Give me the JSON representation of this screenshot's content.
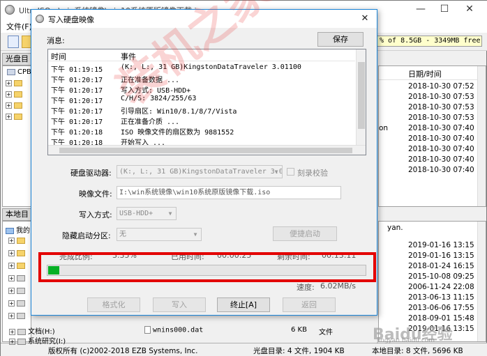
{
  "main_window": {
    "title": "UltraISO - \\win系统镜像\\win10系统原版镜像下载.iso",
    "menu_first": "文件(F)",
    "capacity": "% of 8.5GB - 3349MB free",
    "cd_panel_label": "光盘目录",
    "cd_root": "CPBA_",
    "local_panel_label": "本地目录",
    "local_root": "我的",
    "list_header_date": "日期/时间",
    "upper_dates": [
      "2018-10-30 07:52",
      "2018-10-30 07:53",
      "2018-10-30 07:53",
      "2018-10-30 07:53",
      "2018-10-30 07:40",
      "2018-10-30 07:40",
      "2018-10-30 07:40",
      "2018-10-30 07:40",
      "2018-10-30 07:40"
    ],
    "upper_fragment": "on",
    "lower_dates": [
      "2019-01-16 13:15",
      "2019-01-16 13:15",
      "2018-01-24 16:15",
      "2015-10-08 09:25",
      "2006-11-24 22:08",
      "2013-06-13 11:15",
      "2013-06-06 17:55",
      "2018-09-01 15:48",
      "2019-01-16 13:15"
    ],
    "lower_fragment": "yan.",
    "tree_docs": "文档(H:)",
    "tree_tools": "系统研究(I:)",
    "file_name": "wnins000.dat",
    "file_size": "6 KB",
    "file_type": "文件",
    "copyright": "版权所有 (c)2002-2018 EZB Systems, Inc.",
    "cd_status": "光盘目录: 4 文件, 1904 KB",
    "local_status": "本地目录: 8 文件, 5696 KB"
  },
  "dialog": {
    "title": "写入硬盘映像",
    "close_glyph": "✕",
    "messages_label": "消息:",
    "save_label": "保存",
    "log_headers": {
      "time": "时间",
      "event": "事件"
    },
    "log": [
      {
        "time": "下午 01:19:15",
        "event": "(K:, L:, 31 GB)KingstonDataTraveler 3.01100"
      },
      {
        "time": "下午 01:20:17",
        "event": "正在准备数据 ..."
      },
      {
        "time": "下午 01:20:17",
        "event": "写入方式: USB-HDD+"
      },
      {
        "time": "下午 01:20:17",
        "event": "C/H/S: 3824/255/63"
      },
      {
        "time": "下午 01:20:17",
        "event": "引导扇区: Win10/8.1/8/7/Vista"
      },
      {
        "time": "下午 01:20:17",
        "event": "正在准备介质 ..."
      },
      {
        "time": "下午 01:20:18",
        "event": "ISO 映像文件的扇区数为 9881552"
      },
      {
        "time": "下午 01:20:18",
        "event": "开始写入 ..."
      }
    ],
    "drive_label": "硬盘驱动器:",
    "drive_value": "(K:, L:, 31 GB)KingstonDataTraveler 3.0110",
    "verify_label": "刻录校验",
    "image_label": "映像文件:",
    "image_value": "I:\\win系统镜像\\win10系统原版镜像下载.iso",
    "write_mode_label": "写入方式:",
    "write_mode_value": "USB-HDD+",
    "hide_label": "隐藏启动分区:",
    "hide_value": "无",
    "quick_boot_label": "便捷启动",
    "progress_info": {
      "done_label": "完成比例:",
      "done_value": "3.35%",
      "elapsed_label": "已用时间:",
      "elapsed_value": "00:00:25",
      "remaining_label": "剩余时间:",
      "remaining_value": "00:13:11"
    },
    "progress_fraction": 0.0335,
    "speed_label": "速度:",
    "speed_value": "6.02MB/s",
    "buttons": {
      "format": "格式化",
      "write": "写入",
      "stop": "终止[A]",
      "back": "返回"
    }
  },
  "watermarks": {
    "center": "装机之家",
    "baidu": "Baidu经验",
    "baidu_url": "jingyan.baidu.com"
  },
  "colors": {
    "progress": "#06b025",
    "highlight": "#e30000",
    "dialog_border": "#1883d7"
  }
}
